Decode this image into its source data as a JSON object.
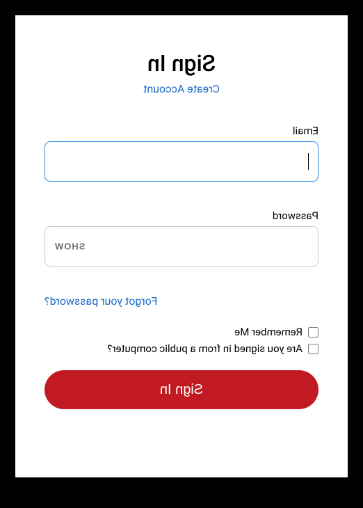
{
  "title": "Sign In",
  "create_account_label": "Create Account",
  "email": {
    "label": "Email",
    "value": "",
    "focused": true
  },
  "password": {
    "label": "Password",
    "value": "",
    "show_toggle_label": "SHOW"
  },
  "forgot_password_label": "Forgot your password?",
  "remember_me_label": "Remember Me",
  "public_computer_label": "Are you signed in from a public computer?",
  "signin_button_label": "Sign In"
}
